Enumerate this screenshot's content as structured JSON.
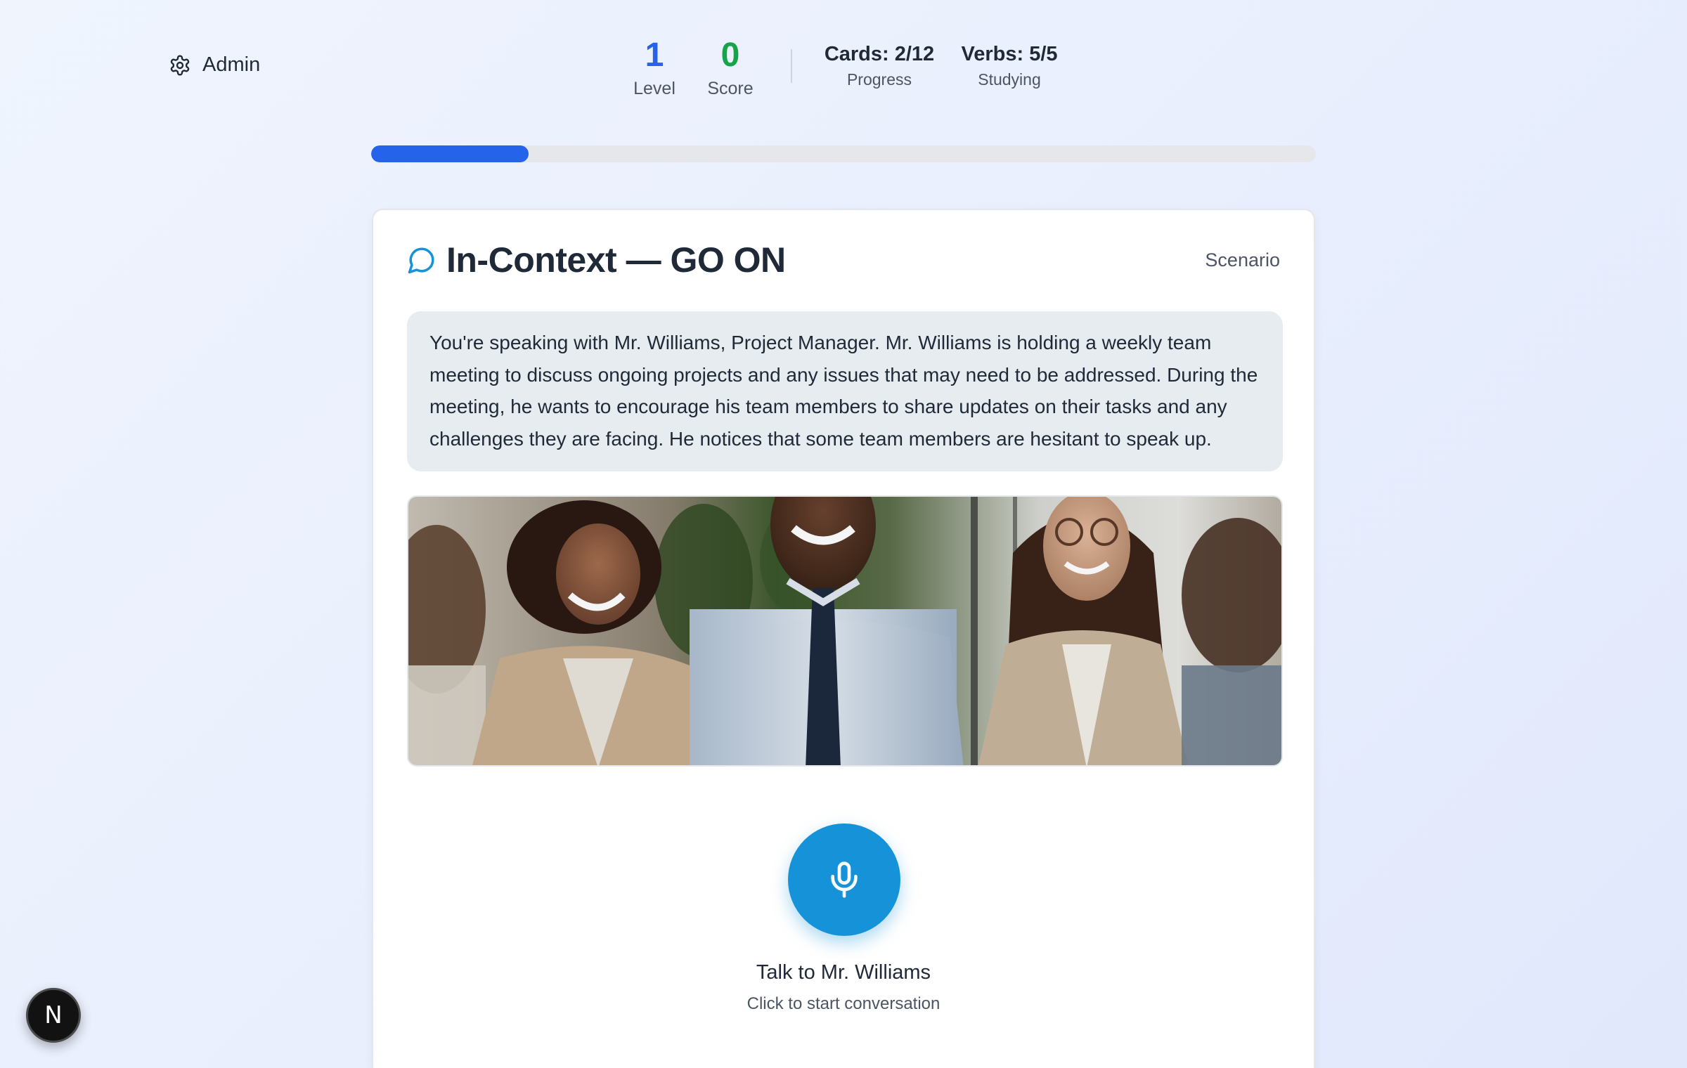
{
  "admin": {
    "label": "Admin",
    "icon": "gear-icon"
  },
  "stats": {
    "level": {
      "value": "1",
      "label": "Level"
    },
    "score": {
      "value": "0",
      "label": "Score"
    },
    "cards": {
      "value": "Cards: 2/12",
      "label": "Progress"
    },
    "verbs": {
      "value": "Verbs: 5/5",
      "label": "Studying"
    }
  },
  "progress": {
    "fraction": 0.167,
    "color": "#2563eb"
  },
  "card": {
    "icon": "chat-bubble-icon",
    "title": "In-Context — GO ON",
    "tag": "Scenario",
    "scenario_text": "You're speaking with Mr. Williams, Project Manager. Mr. Williams is holding a weekly team meeting to discuss ongoing projects and any issues that may need to be addressed. During the meeting, he wants to encourage his team members to share updates on their tasks and any challenges they are facing. He notices that some team members are hesitant to speak up.",
    "image": "team-meeting-photo"
  },
  "mic": {
    "icon": "microphone-icon",
    "label": "Talk to Mr. Williams",
    "hint": "Click to start conversation"
  },
  "badge": {
    "letter": "N"
  },
  "colors": {
    "accent": "#1592d8",
    "level": "#2563eb",
    "score": "#16a34a"
  }
}
